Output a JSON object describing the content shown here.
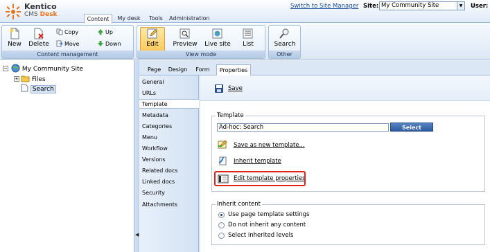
{
  "header": {
    "logo_brand": "Kentico",
    "logo_sub_a": "CMS ",
    "logo_sub_b": "Desk",
    "tabs": [
      "Content",
      "My desk",
      "Tools",
      "Administration"
    ],
    "switch_link": "Switch to Site Manager",
    "site_label": "Site:",
    "site_value": "My Community Site",
    "user_label": "User: Global"
  },
  "ribbon": {
    "content_management": {
      "title": "Content management",
      "new": "New",
      "delete": "Delete",
      "copy": "Copy",
      "move": "Move",
      "up": "Up",
      "down": "Down"
    },
    "view_mode": {
      "title": "View mode",
      "edit": "Edit",
      "preview": "Preview",
      "live_site": "Live site",
      "list": "List"
    },
    "other": {
      "title": "Other",
      "search": "Search"
    }
  },
  "tree": {
    "root": "My Community Site",
    "files": "Files",
    "search": "Search"
  },
  "page_tabs": [
    "Page",
    "Design",
    "Form",
    "Properties"
  ],
  "properties_nav": [
    "General",
    "URLs",
    "Template",
    "Metadata",
    "Categories",
    "Menu",
    "Workflow",
    "Versions",
    "Related docs",
    "Linked docs",
    "Security",
    "Attachments"
  ],
  "toolbar": {
    "save": "Save"
  },
  "template_section": {
    "legend": "Template",
    "value": "Ad-hoc: Search",
    "select_button": "Select",
    "save_as_new": "Save as new template...",
    "inherit": "Inherit template",
    "edit_properties": "Edit template properties"
  },
  "inherit_section": {
    "legend": "Inherit content",
    "options": [
      "Use page template settings",
      "Do not inherit any content",
      "Select inherited levels"
    ],
    "selected_index": 0
  },
  "colors": {
    "highlight": "#e0241b",
    "select_button": "#2b5a9e",
    "link": "#1a4fa0"
  }
}
